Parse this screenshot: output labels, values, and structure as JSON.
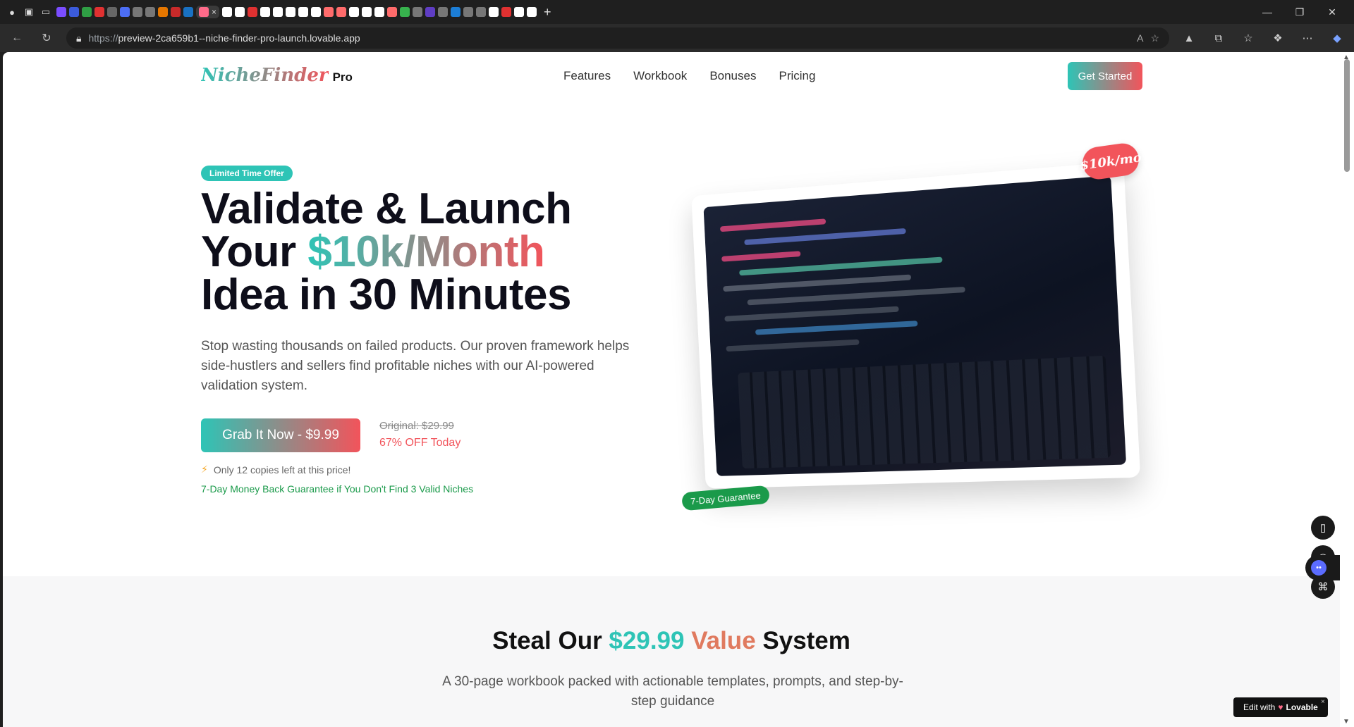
{
  "browser": {
    "url_proto": "https://",
    "url_host": "preview-2ca659b1--niche-finder-pro-launch.lovable.app",
    "tab_close": "×",
    "new_tab": "+"
  },
  "site": {
    "logo_script": "NicheFinder",
    "logo_pro": "Pro",
    "menu": [
      "Features",
      "Workbook",
      "Bonuses",
      "Pricing"
    ],
    "cta_top": "Get Started"
  },
  "hero": {
    "badge": "Limited Time Offer",
    "headline_1": "Validate & Launch",
    "headline_2a": "Your ",
    "headline_2b": "$10k/Month",
    "headline_3": "Idea in 30 Minutes",
    "sub": "Stop wasting thousands on failed products. Our proven framework helps side-hustlers and sellers find profitable niches with our AI-powered validation system.",
    "buy_label": "Grab It Now - $9.99",
    "original_price": "Original: $29.99",
    "discount": "67% OFF Today",
    "scarcity": "Only 12 copies left at this price!",
    "guarantee": "7-Day Money Back Guarantee if You Don't Find 3 Valid Niches",
    "price_pill": "$10k/mo",
    "guarantee_pill": "7-Day Guarantee"
  },
  "section2": {
    "title_a": "Steal Our ",
    "title_b": "$29.99",
    "title_c": " Value",
    "title_d": " System",
    "sub": "A 30-page workbook packed with actionable templates, prompts, and step-by-step guidance"
  },
  "lovable": {
    "prefix": "Edit with",
    "brand": "Lovable"
  },
  "colors": {
    "teal": "#2ec4b6",
    "coral": "#f2545b",
    "green": "#1a9a4a"
  }
}
